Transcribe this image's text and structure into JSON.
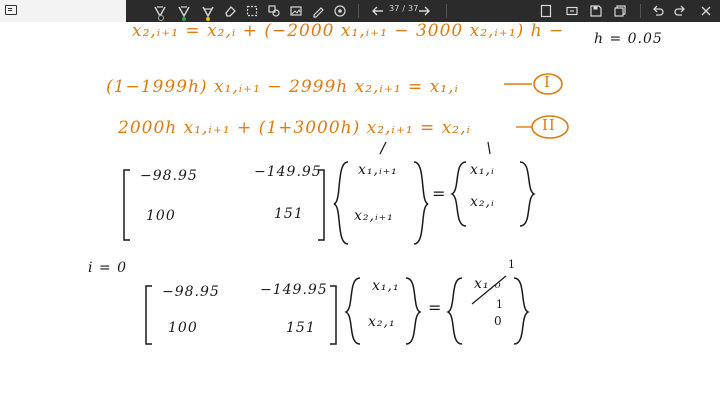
{
  "toolbar": {
    "page_indicator": "37 / 37",
    "icons": [
      "pen-icon",
      "pen-icon",
      "highlighter-icon",
      "eraser-icon",
      "lasso-icon",
      "shapes-icon",
      "image-icon",
      "pen-settings-icon",
      "brush-icon",
      "prev-page-icon",
      "next-page-icon",
      "view-icon",
      "open-icon",
      "present-icon",
      "save-icon",
      "copy-icon",
      "undo-icon",
      "redo-icon",
      "close-icon"
    ]
  },
  "notes": {
    "line1": "x₂,ᵢ₊₁ = x₂,ᵢ + (−2000 x₁,ᵢ₊₁ − 3000 x₂,ᵢ₊₁) h −",
    "h_value": "h = 0.05",
    "line2": "(1−1999h) x₁,ᵢ₊₁ − 2999h x₂,ᵢ₊₁ = x₁,ᵢ",
    "label1": "I",
    "line3": "2000h x₁,ᵢ₊₁ + (1+3000h) x₂,ᵢ₊₁ = x₂,ᵢ",
    "label2": "II",
    "matrix1": {
      "r1c1": "−98.95",
      "r1c2": "−149.95",
      "r2c1": "100",
      "r2c2": "151",
      "v1": "x₁,ᵢ₊₁",
      "v2": "x₂,ᵢ₊₁",
      "eq": "=",
      "rhs1": "x₁,ᵢ",
      "rhs2": "x₂,ᵢ"
    },
    "i_eq": "i = 0",
    "matrix2": {
      "r1c1": "−98.95",
      "r1c2": "−149.95",
      "r2c1": "100",
      "r2c2": "151",
      "v1": "x₁,₁",
      "v2": "x₂,₁",
      "eq": "=",
      "rhs1": "x₁,₀",
      "rhs2": "0",
      "mark_top": "1",
      "mark_mid": "1"
    }
  }
}
